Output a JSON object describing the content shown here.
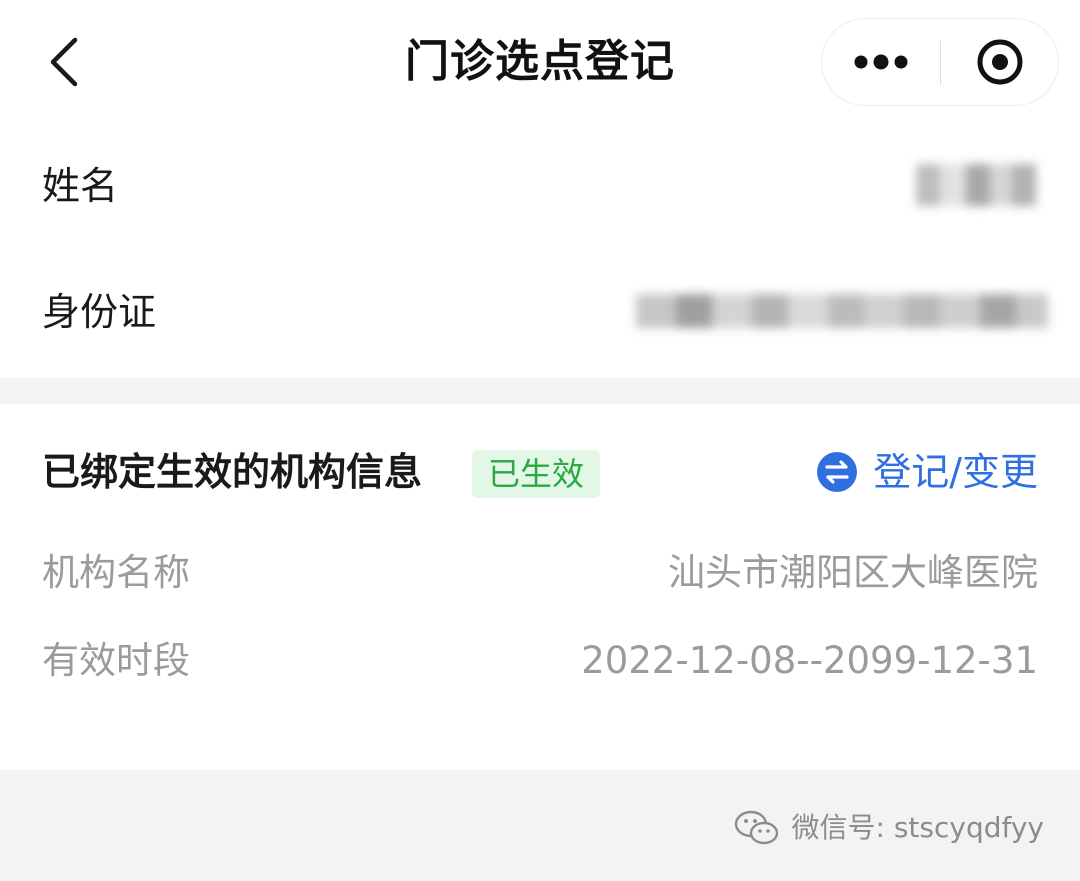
{
  "navbar": {
    "title": "门诊选点登记",
    "back_icon": "chevron-left-icon",
    "more_icon": "more-dots-icon",
    "close_icon": "target-close-icon"
  },
  "person": {
    "name_label": "姓名",
    "id_label": "身份证"
  },
  "institution": {
    "section_title": "已绑定生效的机构信息",
    "status": "已生效",
    "change_label": "登记/变更",
    "change_icon": "swap-arrows-icon",
    "org_name_label": "机构名称",
    "org_name_value": "汕头市潮阳区大峰医院",
    "period_label": "有效时段",
    "period_value": "2022-12-08--2099-12-31"
  },
  "footer": {
    "watermark_text": "微信号: stscyqdfyy",
    "watermark_icon": "wechat-icon"
  },
  "colors": {
    "accent_blue": "#2f6fe0",
    "status_green": "#2aa845",
    "status_green_bg": "#e3f7e6",
    "muted_text": "#9b9b9b",
    "section_gap": "#f3f3f3"
  }
}
